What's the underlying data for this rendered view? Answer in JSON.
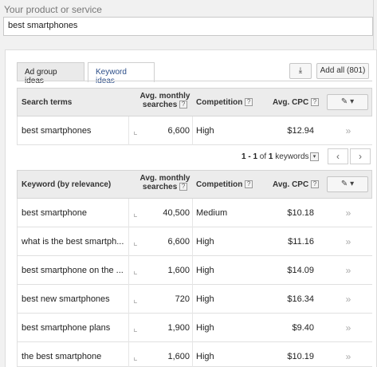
{
  "product": {
    "label": "Your product or service",
    "value": "best smartphones"
  },
  "tabs": [
    {
      "label": "Ad group ideas",
      "active": false
    },
    {
      "label": "Keyword ideas",
      "active": true
    }
  ],
  "toolbar": {
    "download_icon": "download-icon",
    "add_all_label": "Add all (801)"
  },
  "search_terms_table": {
    "headers": {
      "term": "Search terms",
      "avg_monthly_line1": "Avg. monthly",
      "avg_monthly_line2": "searches",
      "competition": "Competition",
      "avg_cpc": "Avg. CPC",
      "help": "?"
    },
    "rows": [
      {
        "term": "best smartphones",
        "searches": "6,600",
        "competition": "High",
        "cpc": "$12.94"
      }
    ]
  },
  "pager": {
    "range": "1 - 1",
    "of_text": "of",
    "total": "1",
    "suffix": "keywords",
    "prev": "‹",
    "next": "›"
  },
  "keyword_table": {
    "headers": {
      "term": "Keyword (by relevance)",
      "avg_monthly_line1": "Avg. monthly",
      "avg_monthly_line2": "searches",
      "competition": "Competition",
      "avg_cpc": "Avg. CPC",
      "help": "?"
    },
    "rows": [
      {
        "term": "best smartphone",
        "searches": "40,500",
        "competition": "Medium",
        "cpc": "$10.18"
      },
      {
        "term": "what is the best smartph...",
        "searches": "6,600",
        "competition": "High",
        "cpc": "$11.16"
      },
      {
        "term": "best smartphone on the ...",
        "searches": "1,600",
        "competition": "High",
        "cpc": "$14.09"
      },
      {
        "term": "best new smartphones",
        "searches": "720",
        "competition": "High",
        "cpc": "$16.34"
      },
      {
        "term": "best smartphone plans",
        "searches": "1,900",
        "competition": "High",
        "cpc": "$9.40"
      },
      {
        "term": "the best smartphone",
        "searches": "1,600",
        "competition": "High",
        "cpc": "$10.19"
      }
    ]
  },
  "icons": {
    "trend": "trend-chart-icon",
    "add_row": "double-chevron-right-icon",
    "column_edit": "pencil-icon",
    "column_dropdown": "caret-down-icon"
  }
}
